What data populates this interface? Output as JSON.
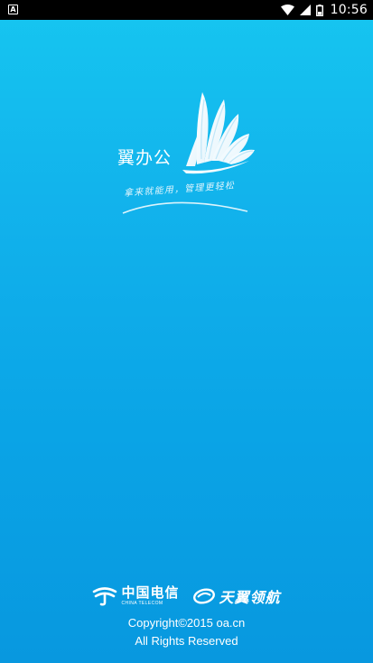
{
  "status_bar": {
    "notification_icon": "a-notification-icon",
    "icons": [
      "wifi-icon",
      "cellular-signal-icon",
      "battery-icon"
    ],
    "time": "10:56"
  },
  "logo": {
    "app_name": "翼办公",
    "slogan": "拿来就能用，管理更轻松",
    "mark_icon": "wing-feather-icon"
  },
  "footer": {
    "china_telecom_cn": "中国电信",
    "china_telecom_en": "CHINA TELECOM",
    "tianyi_name": "天翼领航",
    "copyright": "Copyright©2015 oa.cn",
    "rights": "All Rights Reserved"
  },
  "colors": {
    "background_top": "#16c6f0",
    "background_bottom": "#0898df",
    "text": "#ffffff"
  }
}
